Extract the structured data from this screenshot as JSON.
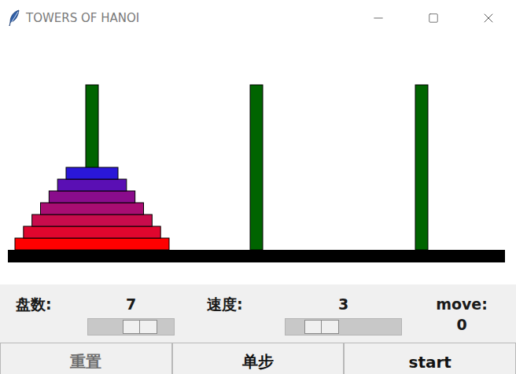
{
  "window": {
    "title": "TOWERS OF HANOI"
  },
  "board": {
    "pegs": [
      {
        "disks": [
          {
            "size": 7,
            "color": "#ff0000"
          },
          {
            "size": 6,
            "color": "#e0062e"
          },
          {
            "size": 5,
            "color": "#c80c4c"
          },
          {
            "size": 4,
            "color": "#a80d72"
          },
          {
            "size": 3,
            "color": "#8a0c8c"
          },
          {
            "size": 2,
            "color": "#5a0fb4"
          },
          {
            "size": 1,
            "color": "#2a17d8"
          }
        ]
      },
      {
        "disks": []
      },
      {
        "disks": []
      }
    ]
  },
  "controls": [
    {
      "label": "盘数:",
      "value": "7",
      "level": 0.67
    },
    {
      "label": "速度:",
      "value": "3",
      "level": 0.23
    }
  ],
  "move": {
    "label": "move:",
    "value": "0"
  },
  "buttons": [
    {
      "label": "重置",
      "disabled": true
    },
    {
      "label": "单步",
      "disabled": false
    },
    {
      "label": "start",
      "disabled": false
    }
  ]
}
